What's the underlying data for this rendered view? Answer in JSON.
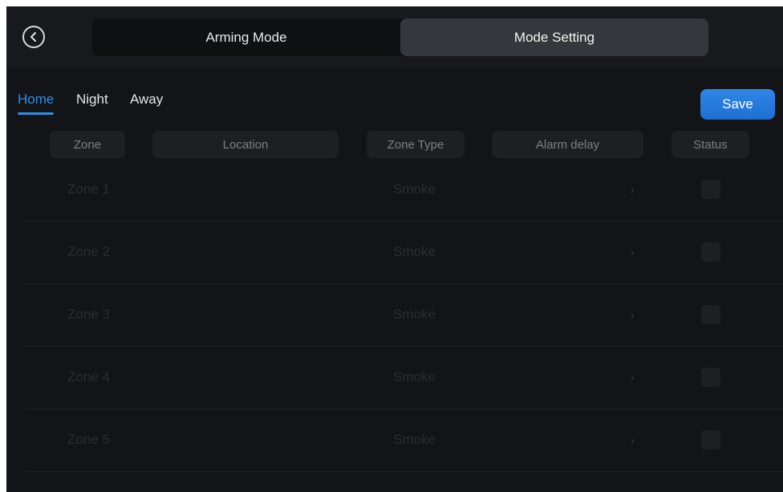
{
  "header": {
    "back_icon": "chevron-left-icon",
    "tabs": [
      {
        "label": "Arming Mode",
        "active": false
      },
      {
        "label": "Mode Setting",
        "active": true
      }
    ]
  },
  "mode_tabs": [
    {
      "label": "Home",
      "active": true
    },
    {
      "label": "Night",
      "active": false
    },
    {
      "label": "Away",
      "active": false
    }
  ],
  "save_label": "Save",
  "columns": [
    "Zone",
    "Location",
    "Zone Type",
    "Alarm delay",
    "Status"
  ],
  "rows": [
    {
      "zone": "Zone 1",
      "location": "",
      "type": "Smoke",
      "delay_icon": "chevron-right-icon",
      "status": false
    },
    {
      "zone": "Zone 2",
      "location": "",
      "type": "Smoke",
      "delay_icon": "chevron-right-icon",
      "status": false
    },
    {
      "zone": "Zone 3",
      "location": "",
      "type": "Smoke",
      "delay_icon": "chevron-right-icon",
      "status": false
    },
    {
      "zone": "Zone 4",
      "location": "",
      "type": "Smoke",
      "delay_icon": "chevron-right-icon",
      "status": false
    },
    {
      "zone": "Zone 5",
      "location": "",
      "type": "Smoke",
      "delay_icon": "chevron-right-icon",
      "status": false
    }
  ],
  "colors": {
    "accent": "#2e8fe6",
    "background": "#131417",
    "active_tab": "#34373b"
  }
}
